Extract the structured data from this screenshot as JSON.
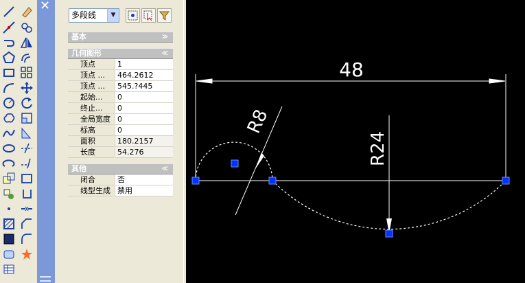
{
  "toolbar": {
    "left_tools": [
      "line-icon",
      "construction-line-icon",
      "polyline-icon",
      "polygon-icon",
      "rectangle-icon",
      "arc-icon",
      "circle-icon",
      "revision-cloud-icon",
      "spline-icon",
      "ellipse-icon",
      "ellipse-arc-icon",
      "insert-block-icon",
      "make-block-icon",
      "point-icon",
      "hatch-icon",
      "gradient-icon",
      "region-icon",
      "table-icon"
    ],
    "right_tools": [
      "erase-icon",
      "copy-icon",
      "mirror-icon",
      "offset-icon",
      "array-icon",
      "move-icon",
      "rotate-icon",
      "scale-icon",
      "stretch-icon",
      "trim-icon",
      "extend-icon",
      "break-icon",
      "join-icon",
      "chamfer-icon",
      "fillet-icon",
      "explode-icon"
    ]
  },
  "palette": {
    "close_glyph": "✕",
    "object_type": "多段线",
    "buttons": [
      "quick-select-icon",
      "select-objects-icon",
      "toggle-pickadd-icon"
    ],
    "sections": [
      {
        "title": "基本",
        "chevron": "≫",
        "rows": []
      },
      {
        "title": "几何图形",
        "chevron": "≪",
        "rows": [
          {
            "label": "顶点",
            "value": "1"
          },
          {
            "label": "顶点 ...",
            "value": "464.2612"
          },
          {
            "label": "顶点 ...",
            "value": "545.?445"
          },
          {
            "label": "起始...",
            "value": "0"
          },
          {
            "label": "终止...",
            "value": "0"
          },
          {
            "label": "全局宽度",
            "value": "0"
          },
          {
            "label": "标高",
            "value": "0"
          },
          {
            "label": "面积",
            "value": "180.2157"
          },
          {
            "label": "长度",
            "value": "54.276"
          }
        ]
      },
      {
        "title": "其他",
        "chevron": "≪",
        "rows": [
          {
            "label": "闭合",
            "value": "否"
          },
          {
            "label": "线型生成",
            "value": "禁用"
          }
        ]
      }
    ]
  },
  "drawing": {
    "dim_width": "48",
    "dim_radius_small": "R8",
    "dim_radius_large": "R24",
    "grip_color": "#0033ff",
    "line_color": "#ffffff"
  }
}
